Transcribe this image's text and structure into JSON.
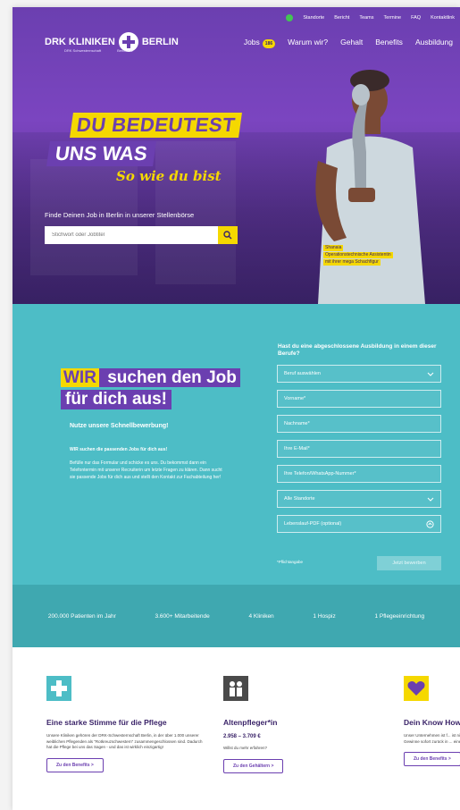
{
  "topbar": {
    "items": [
      "Standorte",
      "Bericht",
      "Teams",
      "Termine",
      "FAQ",
      "Kontaktlink"
    ]
  },
  "logo": {
    "left": "DRK KLINIKEN",
    "right": "BERLIN",
    "sub_left": "DRK Schwesternschaft",
    "sub_right": "Berlin e.V."
  },
  "nav": {
    "items": [
      "Jobs",
      "Warum wir?",
      "Gehalt",
      "Benefits",
      "Ausbildung"
    ],
    "jobs_badge": "186"
  },
  "hero": {
    "slogan_line1": "DU BEDEUTEST",
    "slogan_line2": "UNS WAS",
    "slogan_line3": "So wie du bist",
    "search_label": "Finde Deinen Job in Berlin in unserer Stellenbörse",
    "search_placeholder": "Stichwort oder Jobtitel",
    "caption_name": "Shanaia",
    "caption_role": "Operationstechnische Assistentin",
    "caption_note": "mit ihrer mega Schachfigur"
  },
  "form": {
    "headline_hl": "WIR",
    "headline_rest1": " suchen den Job",
    "headline_line2": "für dich aus!",
    "nutze": "Nutze unsere Schnellbewerbung!",
    "wir_text": "WIR suchen die passenden Jobs für dich aus!",
    "befuelle": "Befülle nur das Formular und schicke es uns. Du bekommst dann ein Telefontermin mit unserer Recruiterin um letzte Fragen zu klären. Dann sucht sie passende Jobs für dich aus und stellt den Kontakt zur Fachabteilung her!",
    "question": "Hast du eine abgeschlossene Ausbildung in einem dieser Berufe?",
    "fields": [
      "Beruf auswählen",
      "Vorname*",
      "Nachname*",
      "Ihre E-Mail*",
      "Ihre Telefon/WhatsApp-Nummer*",
      "Alle Standorte",
      "Lebenslauf-PDF (optional)"
    ],
    "pflicht": "*Pflichtangabe",
    "submit": "Jetzt bewerben"
  },
  "stats": [
    "200.000 Patienten im Jahr",
    "3.600+ Mitarbeitende",
    "4 Kliniken",
    "1 Hospiz",
    "1 Pflegeeinrichtung"
  ],
  "cards": [
    {
      "title": "Eine starke Stimme für die Pflege",
      "text": "Unsere Kliniken gehören der DRK-Schwesternschaft Berlin, in der über 1.000 unserer weiblichen Pflegenden als \"Rotkreuzschwestern\" zusammengeschlossen sind. Dadurch hat die Pflege bei uns das Sagen - und das ist wirklich einzigartig!",
      "button": "Zu den Benefits >"
    },
    {
      "title": "Altenpfleger*in",
      "price": "2.958 – 3.709 €",
      "text": "Willst du mehr erfahren?",
      "button": "Zu den Gehältern >"
    },
    {
      "title": "Dein Know How",
      "text": "Unser Unternehmen ist f... ist nicht auf Profit ausge... Gewinne sofort zurück in ... eine gute Sache!",
      "button": "Zu den Benefits >"
    }
  ],
  "colors": {
    "purple": "#6b3fb0",
    "yellow": "#f5d800",
    "teal": "#4dbdc6",
    "teal_dark": "#3fa8b0"
  }
}
